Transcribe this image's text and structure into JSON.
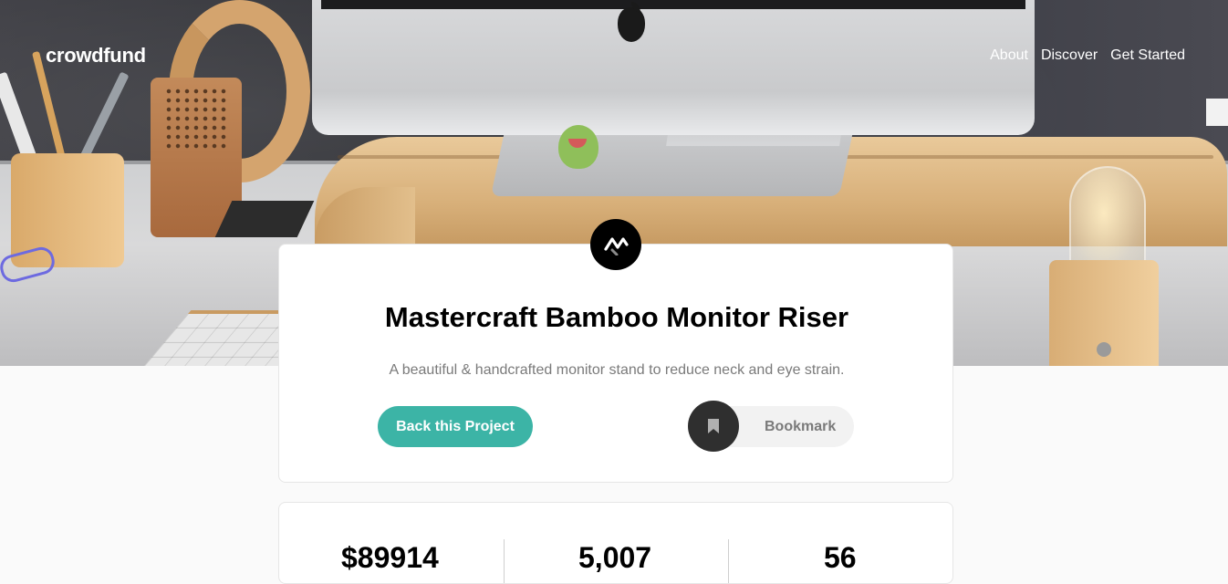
{
  "header": {
    "logo_text": "crowdfund",
    "nav": [
      {
        "label": "About"
      },
      {
        "label": "Discover"
      },
      {
        "label": "Get Started"
      }
    ]
  },
  "project": {
    "title": "Mastercraft Bamboo Monitor Riser",
    "description": "A beautiful & handcrafted monitor stand to reduce neck and eye strain.",
    "brand_icon": "mastercraft-logo-icon",
    "back_label": "Back this Project",
    "bookmark_label": "Bookmark",
    "bookmark_icon": "bookmark-icon"
  },
  "stats": {
    "amount_backed": "$89914",
    "total_backers": "5,007",
    "days_left": "56"
  },
  "colors": {
    "accent": "#3cb4a6",
    "dark": "#2f2f2f",
    "text_muted": "#7a7a7a"
  }
}
